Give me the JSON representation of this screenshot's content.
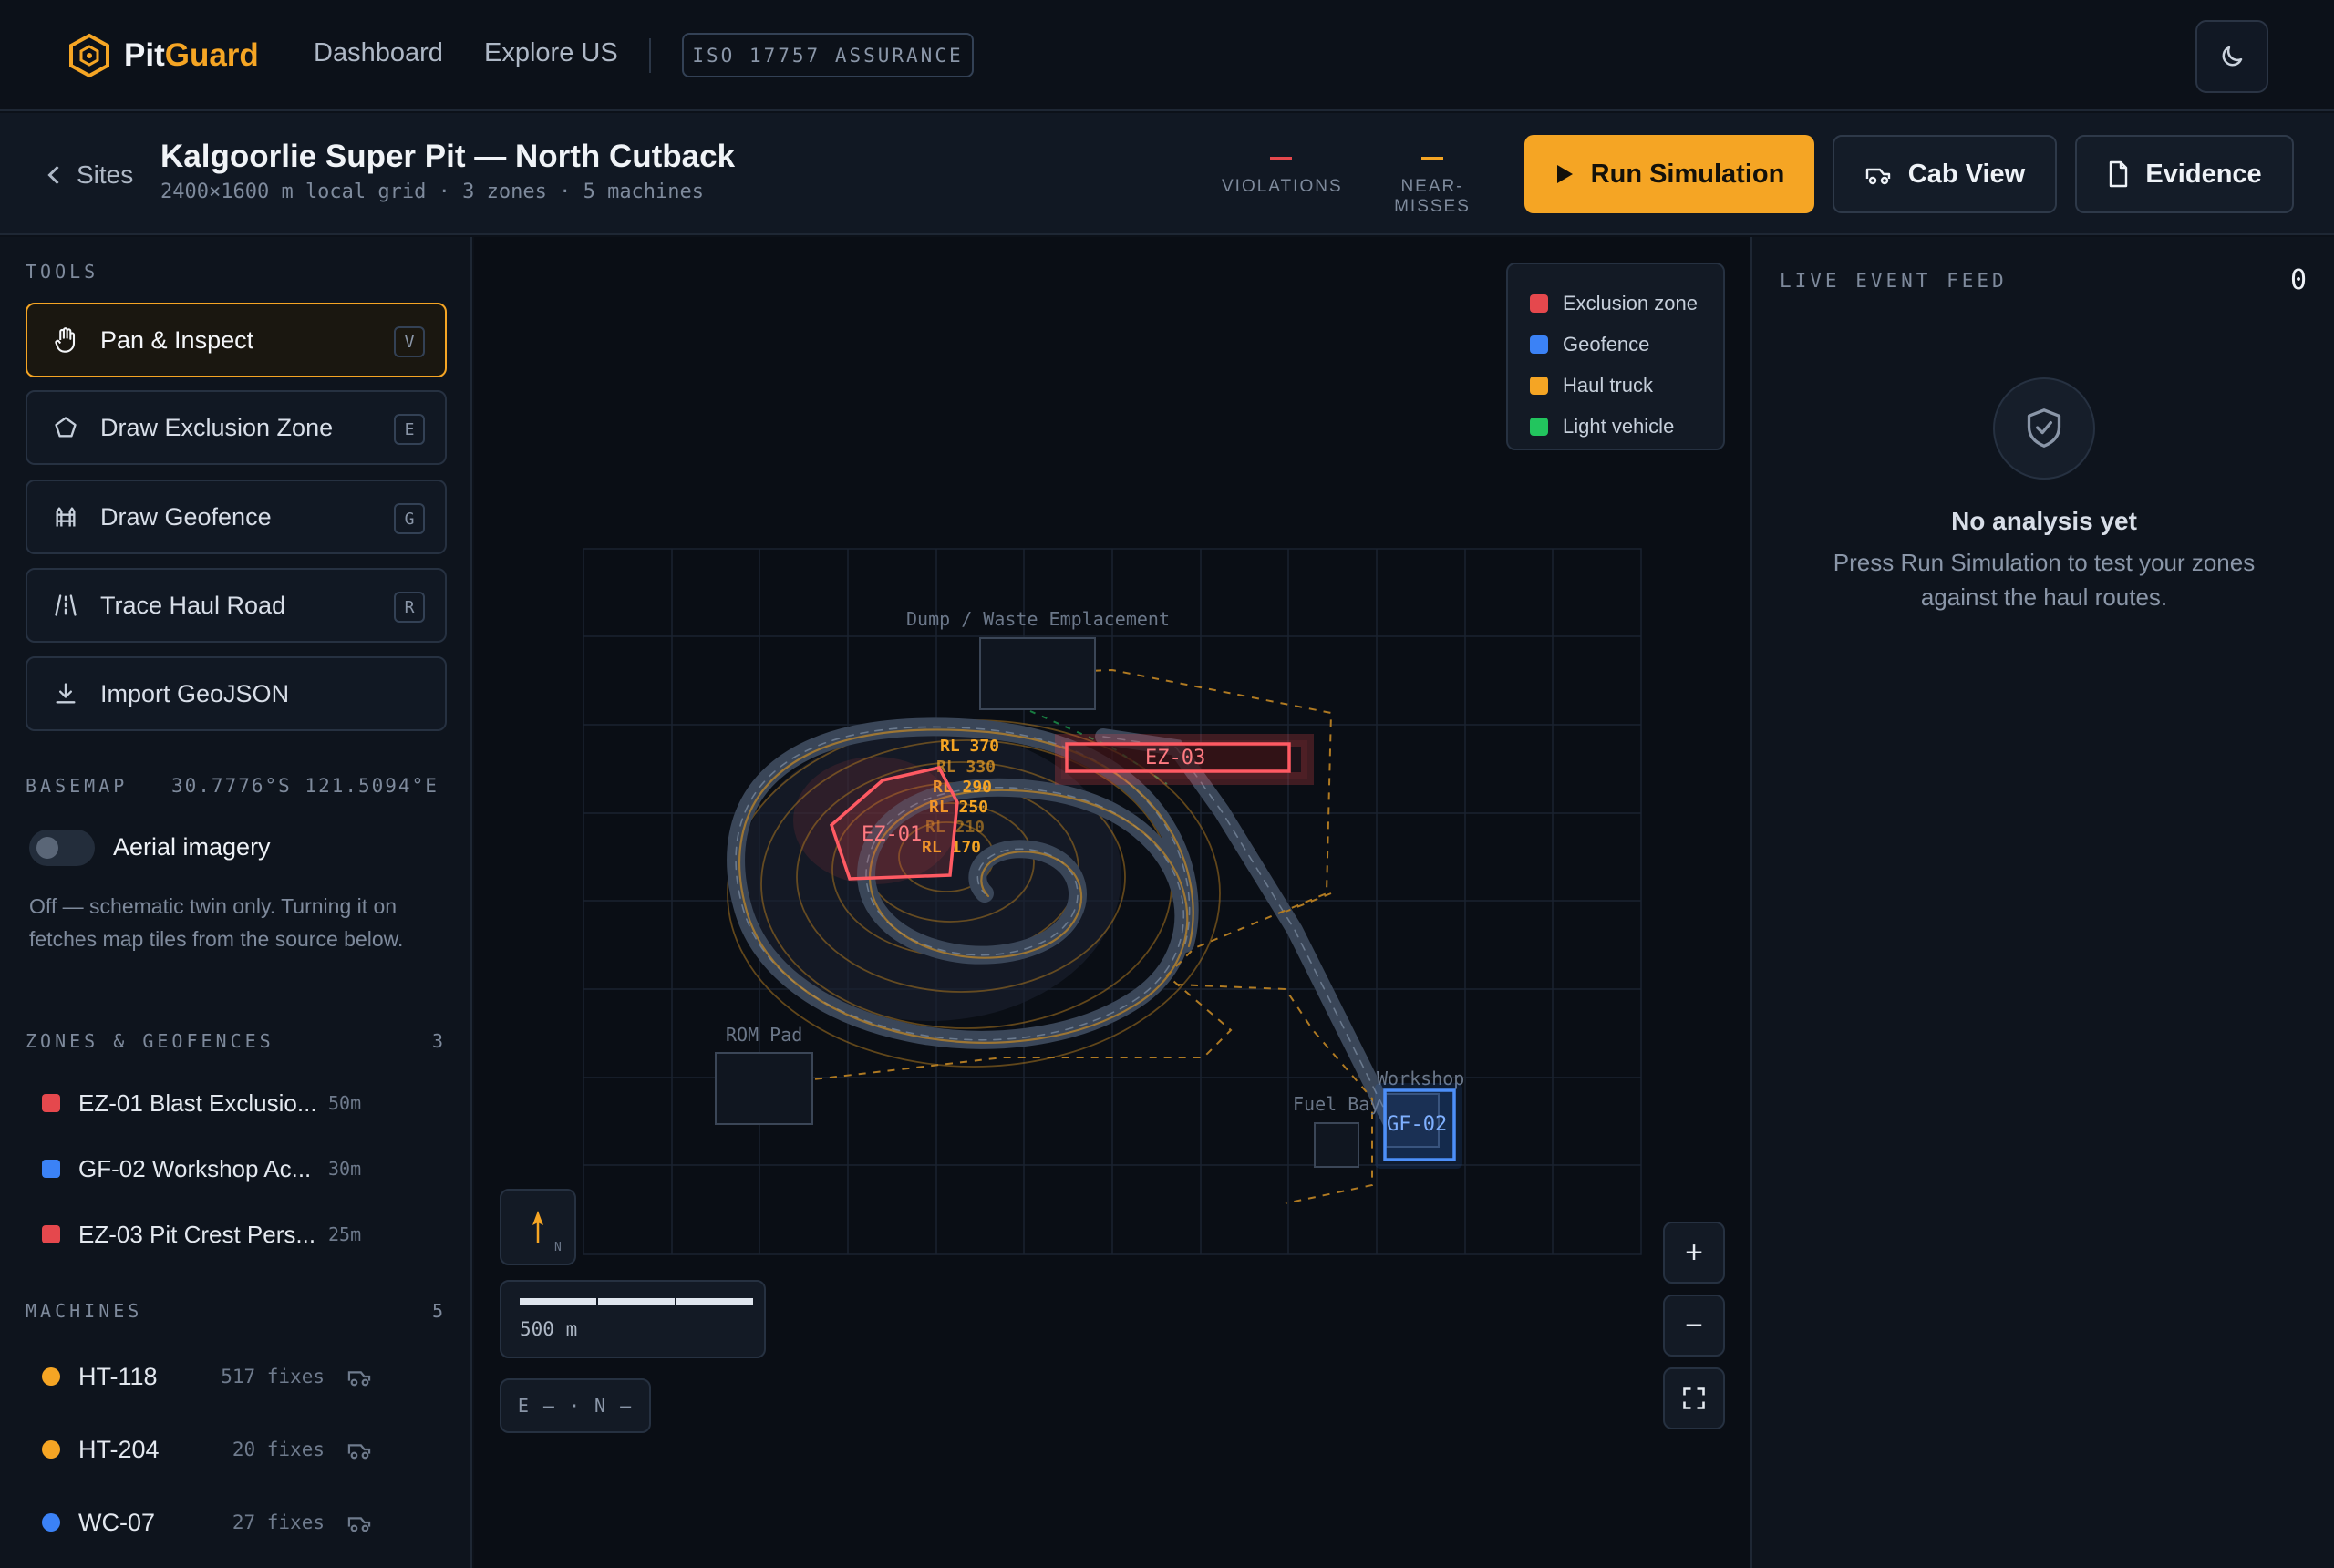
{
  "app": {
    "brand_a": "Pit",
    "brand_b": "Guard",
    "nav": [
      "Dashboard",
      "Explore US"
    ],
    "badge": "ISO 17757 ASSURANCE",
    "accent": "#f5a524"
  },
  "header": {
    "back_label": "Sites",
    "title": "Kalgoorlie Super Pit — North Cutback",
    "subtitle": "2400×1600 m local grid · 3 zones · 5 machines",
    "stats": [
      {
        "label": "VIOLATIONS",
        "color": "#e5484d"
      },
      {
        "label": "NEAR-MISSES",
        "color": "#f5a524"
      }
    ],
    "run_label": "Run Simulation",
    "cab_label": "Cab View",
    "evidence_label": "Evidence"
  },
  "sidebar": {
    "tools_label": "TOOLS",
    "tools": [
      {
        "label": "Pan & Inspect",
        "key": "V",
        "icon": "hand-icon",
        "active": true
      },
      {
        "label": "Draw Exclusion Zone",
        "key": "E",
        "icon": "pentagon-icon"
      },
      {
        "label": "Draw Geofence",
        "key": "G",
        "icon": "fence-icon"
      },
      {
        "label": "Trace Haul Road",
        "key": "R",
        "icon": "road-icon"
      },
      {
        "label": "Import GeoJSON",
        "key": "",
        "icon": "download-icon"
      }
    ],
    "basemap_label": "BASEMAP",
    "basemap_coords": "30.7776°S 121.5094°E",
    "aerial_label": "Aerial imagery",
    "aerial_on": false,
    "basemap_note": "Off — schematic twin only. Turning it on fetches map tiles from the source below.",
    "zones_label": "ZONES & GEOFENCES",
    "zones_count": "3",
    "zones": [
      {
        "name": "EZ-01 Blast Exclusio...",
        "meta": "50m",
        "color": "#e5484d"
      },
      {
        "name": "GF-02 Workshop Ac...",
        "meta": "30m",
        "color": "#3b82f6"
      },
      {
        "name": "EZ-03 Pit Crest Pers...",
        "meta": "25m",
        "color": "#e5484d"
      }
    ],
    "machines_label": "MACHINES",
    "machines_count": "5",
    "machines": [
      {
        "name": "HT-118",
        "fixes": "517 fixes",
        "color": "#f5a524"
      },
      {
        "name": "HT-204",
        "fixes": "20 fixes",
        "color": "#f5a524"
      },
      {
        "name": "WC-07",
        "fixes": "27 fixes",
        "color": "#3b82f6"
      }
    ]
  },
  "map": {
    "legend": [
      {
        "label": "Exclusion zone",
        "color": "#e5484d"
      },
      {
        "label": "Geofence",
        "color": "#3b82f6"
      },
      {
        "label": "Haul truck",
        "color": "#f5a524"
      },
      {
        "label": "Light vehicle",
        "color": "#22c55e"
      }
    ],
    "places": {
      "dump": "Dump / Waste Emplacement",
      "rom": "ROM Pad",
      "fuel": "Fuel Bay",
      "workshop": "Workshop"
    },
    "zone_labels": {
      "ez01": "EZ-01",
      "ez03": "EZ-03",
      "gf02": "GF-02"
    },
    "benches": [
      "RL 370",
      "RL 330",
      "RL 290",
      "RL 250",
      "RL 210",
      "RL 170"
    ],
    "compass": "N",
    "scale_label": "500 m",
    "coord_readout": "E — · N —",
    "zoom_in": "+",
    "zoom_out": "−"
  },
  "feed": {
    "label": "LIVE EVENT FEED",
    "count": "0",
    "empty_title": "No analysis yet",
    "empty_text": "Press Run Simulation to test your zones against the haul routes."
  }
}
